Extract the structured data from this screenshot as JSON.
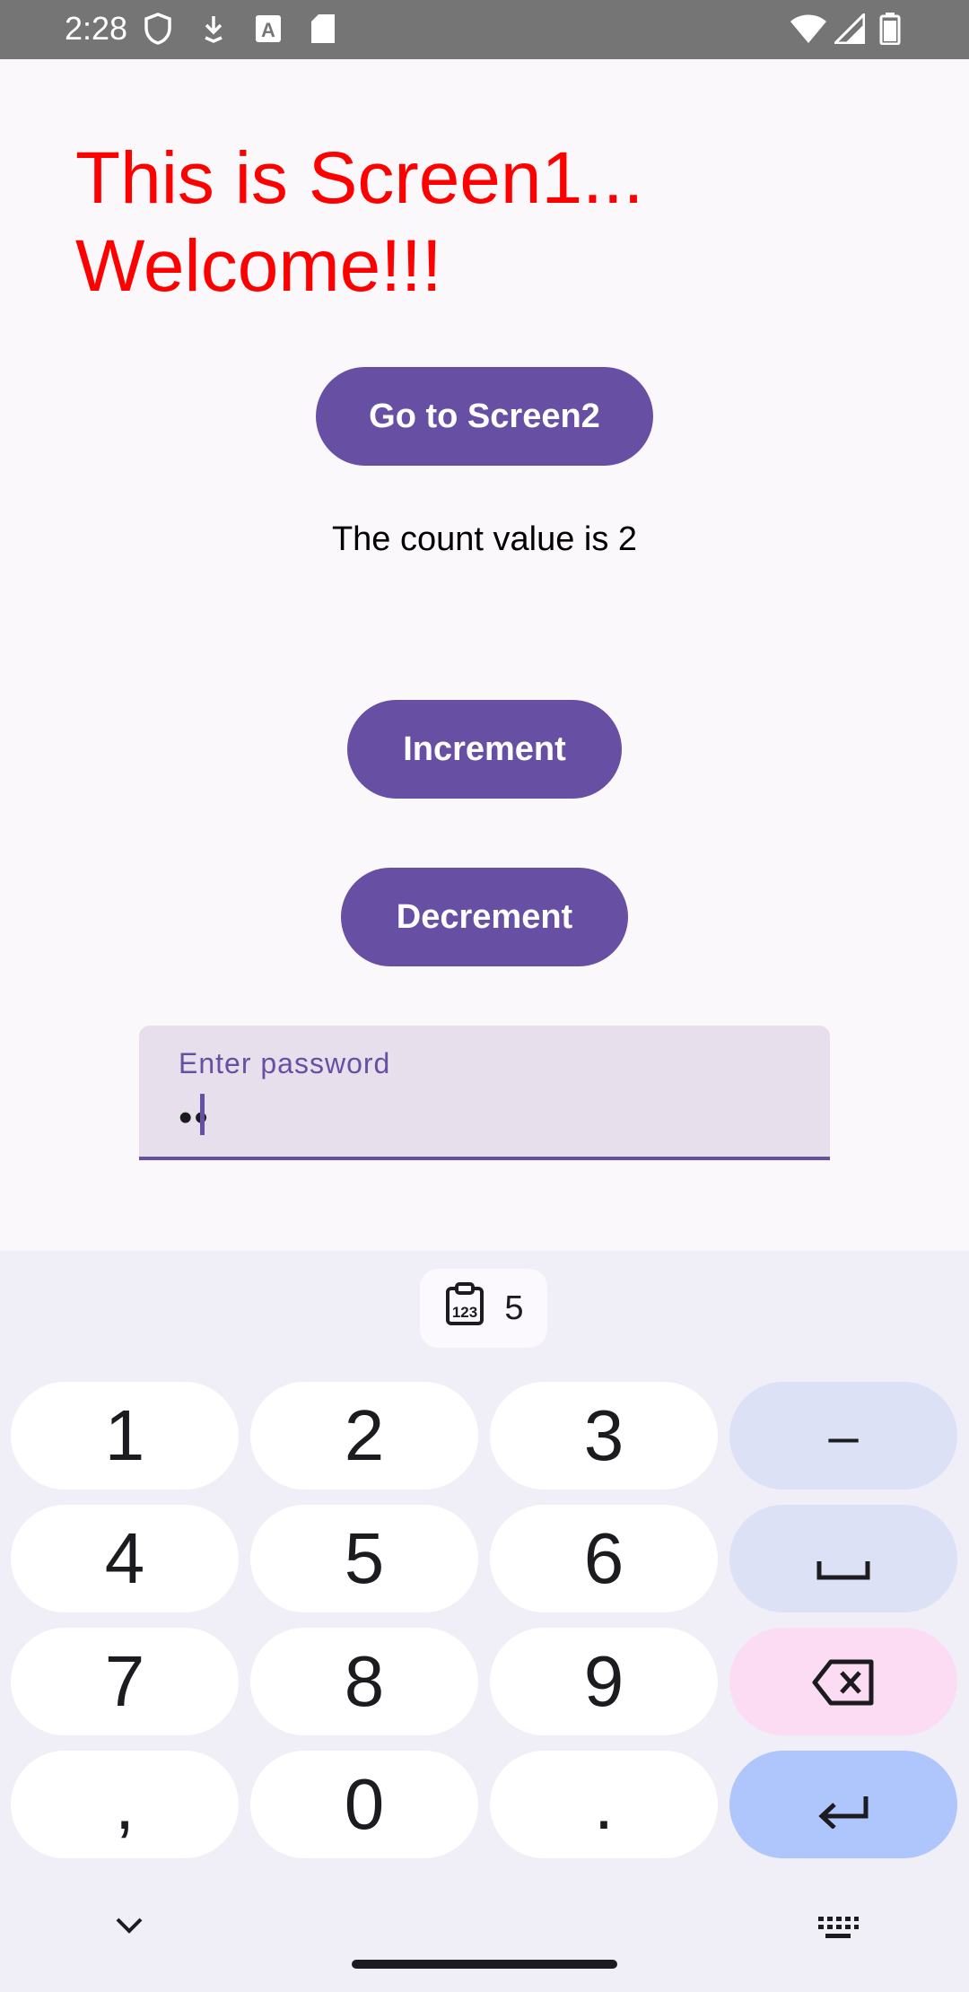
{
  "status_bar": {
    "time": "2:28",
    "icons": [
      "shield-icon",
      "download-icon",
      "text-icon",
      "sdcard-icon",
      "wifi-icon",
      "signal-icon",
      "battery-icon"
    ]
  },
  "screen": {
    "title_line1": "This is Screen1...",
    "title_line2": "Welcome!!!",
    "go_button_label": "Go to Screen2",
    "count_text": "The count value is 2",
    "increment_label": "Increment",
    "decrement_label": "Decrement",
    "password_label": "Enter password",
    "password_value": "••"
  },
  "keyboard": {
    "clipboard_chip_text": "5",
    "rows": [
      [
        "1",
        "2",
        "3",
        "–"
      ],
      [
        "4",
        "5",
        "6",
        "␣"
      ],
      [
        "7",
        "8",
        "9",
        "⌫"
      ],
      [
        ",",
        "0",
        ".",
        "↵"
      ]
    ]
  },
  "colors": {
    "title": "#ff0000",
    "primary": "#6750a4",
    "status_bar": "#757575",
    "field_bg": "#e7dfec"
  }
}
